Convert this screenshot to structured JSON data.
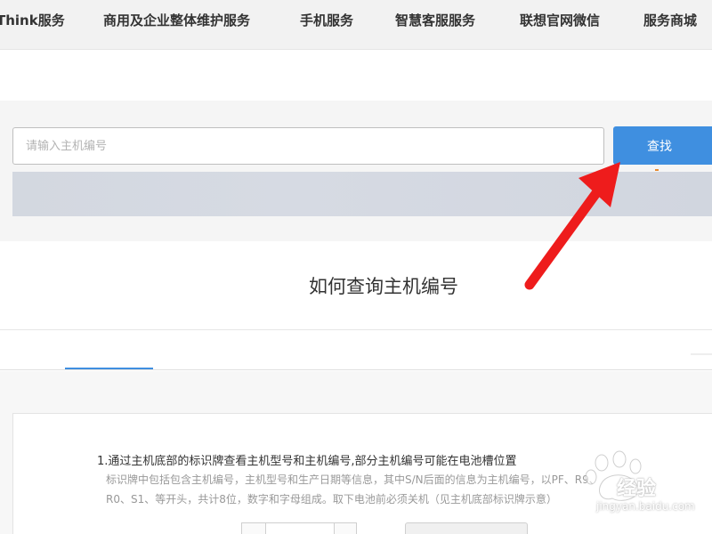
{
  "nav": {
    "items": [
      {
        "label": "Think服务"
      },
      {
        "label": "商用及企业整体维护服务"
      },
      {
        "label": "手机服务"
      },
      {
        "label": "智慧客服服务"
      },
      {
        "label": "联想官网微信"
      },
      {
        "label": "服务商城"
      }
    ]
  },
  "search": {
    "placeholder": "请输入主机编号",
    "value": "",
    "button_label": "查找"
  },
  "section": {
    "title": "如何查询主机编号"
  },
  "step": {
    "title": "1.通过主机底部的标识牌查看主机型号和主机编号,部分主机编号可能在电池槽位置",
    "desc_line1": "标识牌中包括包含主机编号，主机型号和生产日期等信息，其中S/N后面的信息为主机编号，以PF、R9、",
    "desc_line2": "R0、S1、等开头，共计8位，数字和字母组成。取下电池前必须关机（见主机底部标识牌示意）"
  },
  "watermark": {
    "text": "经验",
    "url": "jingyan.baidu.com"
  },
  "colors": {
    "accent": "#3f8fe0",
    "arrow": "#ee1c1c",
    "nav_bg": "#f2f2f2"
  }
}
